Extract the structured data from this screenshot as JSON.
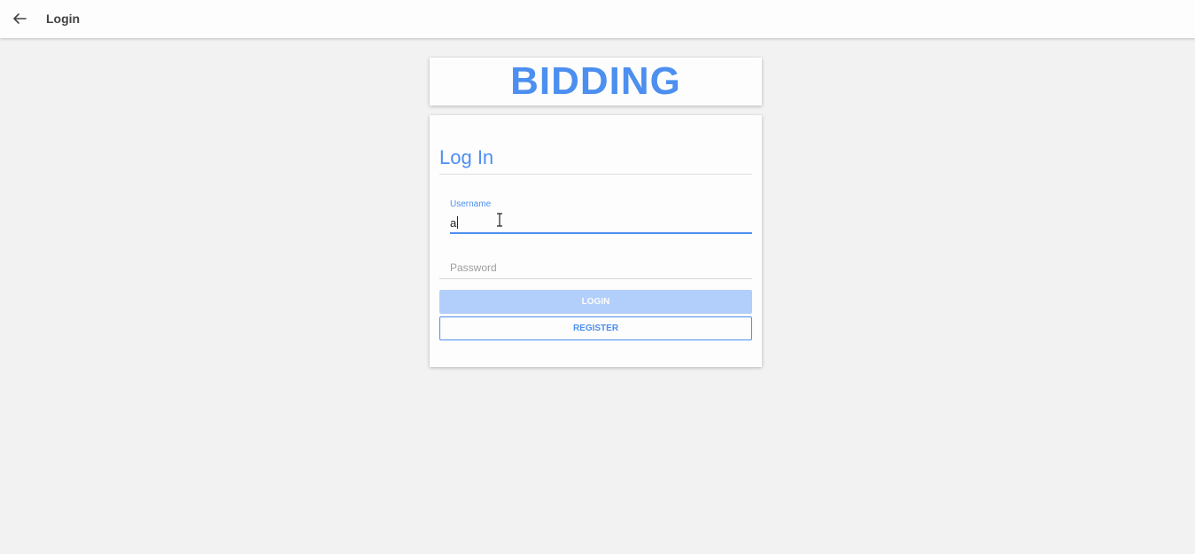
{
  "toolbar": {
    "back_icon": "arrow-left-icon",
    "title": "Login"
  },
  "brand": {
    "name": "BIDDING",
    "color": "#4d8ff0"
  },
  "login_form": {
    "heading": "Log In",
    "username": {
      "label": "Username",
      "value": "a"
    },
    "password": {
      "placeholder": "Password",
      "value": ""
    },
    "login_label": "LOGIN",
    "register_label": "REGISTER"
  },
  "colors": {
    "accent": "#4d8ff0",
    "login_button_disabled": "#b2cefb",
    "background": "#f2f2f2"
  }
}
